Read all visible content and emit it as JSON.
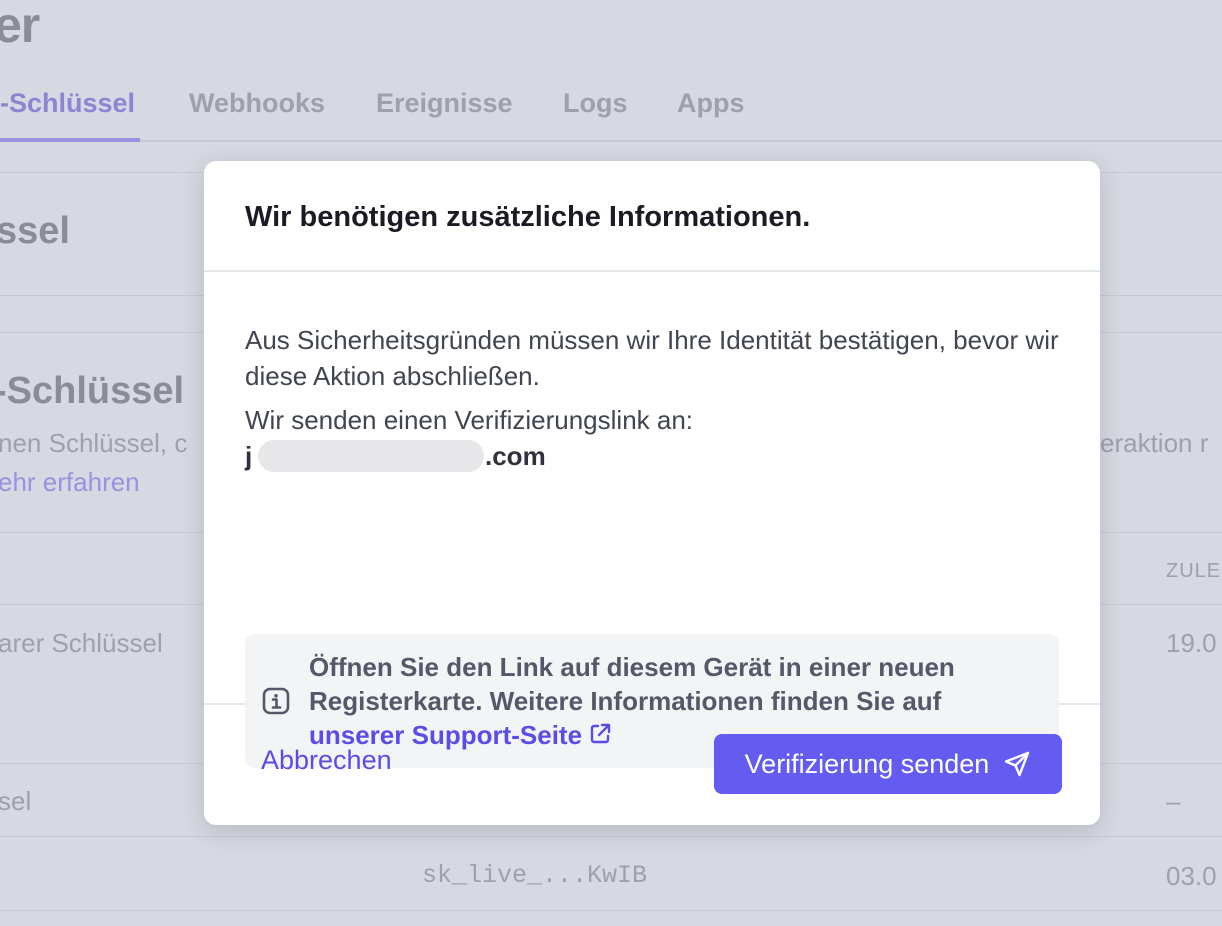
{
  "background": {
    "title": "er",
    "tabs": [
      "-Schlüssel",
      "Webhooks",
      "Ereignisse",
      "Logs",
      "Apps"
    ],
    "section_title": "ssel",
    "subsection_title": "-Schlüssel",
    "desc_left": "nen Schlüssel, c",
    "desc_right": "eraktion r",
    "learn_more": "ehr erfahren",
    "column_header": "ZULE",
    "rows": [
      {
        "name": "arer Schlüssel",
        "date": "19.0"
      },
      {
        "name": "sel",
        "date": "–"
      },
      {
        "key": "sk_live_...KwIB",
        "date": "03.0"
      }
    ]
  },
  "modal": {
    "title": "Wir benötigen zusätzliche Informationen.",
    "paragraph": "Aus Sicherheitsgründen müssen wir Ihre Identität bestätigen, bevor wir diese Aktion abschließen.",
    "send_to": "Wir senden einen Verifizierungslink an:",
    "email_prefix": "j",
    "email_suffix": ".com",
    "info_text": "Öffnen Sie den Link auf diesem Gerät in einer neuen Registerkarte. Weitere Informationen finden Sie auf",
    "info_link": "unserer Support-Seite",
    "cancel_label": "Abbrechen",
    "send_label": "Verifizierung senden",
    "icons": {
      "info": "info-icon",
      "external": "external-link-icon",
      "send": "paper-plane-icon"
    },
    "colors": {
      "accent": "#645cf0",
      "link": "#5b4ce8",
      "info_bg": "#f3f4f6",
      "overlay": "#d6d9e1"
    }
  }
}
